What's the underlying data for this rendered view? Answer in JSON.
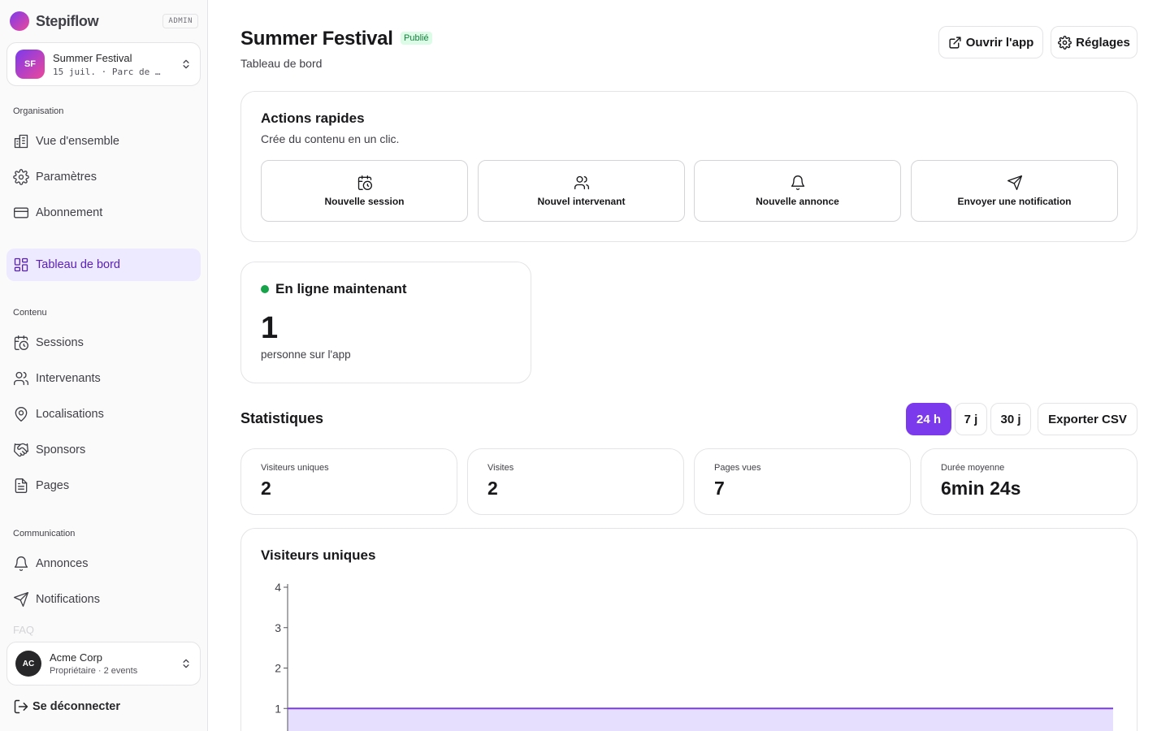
{
  "brand": {
    "name": "Stepiflow",
    "tag": "ADMIN"
  },
  "event": {
    "initials": "SF",
    "name": "Summer Festival",
    "details": "15 juil. · Parc de …"
  },
  "sections": {
    "organisation": "Organisation",
    "contenu": "Contenu",
    "communication": "Communication"
  },
  "nav": {
    "overview": "Vue d'ensemble",
    "settings": "Paramètres",
    "subscription": "Abonnement",
    "dashboard": "Tableau de bord",
    "sessions": "Sessions",
    "speakers": "Intervenants",
    "locations": "Localisations",
    "sponsors": "Sponsors",
    "pages": "Pages",
    "announcements": "Annonces",
    "notifications": "Notifications",
    "faq_partial": "FAQ"
  },
  "org": {
    "initials": "AC",
    "name": "Acme Corp",
    "details": "Propriétaire · 2 events"
  },
  "logout": "Se déconnecter",
  "header": {
    "title": "Summer Festival",
    "status": "Publié",
    "subtitle": "Tableau de bord",
    "open_app": "Ouvrir l'app",
    "settings": "Réglages"
  },
  "quick_actions": {
    "title": "Actions rapides",
    "subtitle": "Crée du contenu en un clic.",
    "items": [
      {
        "icon": "calendar-clock-icon",
        "label": "Nouvelle session"
      },
      {
        "icon": "users-icon",
        "label": "Nouvel intervenant"
      },
      {
        "icon": "bell-icon",
        "label": "Nouvelle annonce"
      },
      {
        "icon": "send-icon",
        "label": "Envoyer une notification"
      }
    ]
  },
  "live": {
    "title": "En ligne maintenant",
    "count": "1",
    "caption": "personne sur l'app",
    "dot_color": "#16a34a"
  },
  "stats": {
    "title": "Statistiques",
    "ranges": [
      "24 h",
      "7 j",
      "30 j"
    ],
    "active_range": "24 h",
    "export": "Exporter CSV",
    "cards": [
      {
        "label": "Visiteurs uniques",
        "value": "2"
      },
      {
        "label": "Visites",
        "value": "2"
      },
      {
        "label": "Pages vues",
        "value": "7"
      },
      {
        "label": "Durée moyenne",
        "value": "6min 24s"
      }
    ]
  },
  "colors": {
    "accent": "#7c3aed",
    "success": "#16a34a",
    "border": "#e4e4e7"
  },
  "chart_data": {
    "type": "area",
    "title": "Visiteurs uniques",
    "y_ticks": [
      "1",
      "2",
      "3",
      "4"
    ],
    "ylim": [
      0,
      4
    ],
    "values": [
      1,
      1
    ],
    "color": "#7c3aed"
  }
}
